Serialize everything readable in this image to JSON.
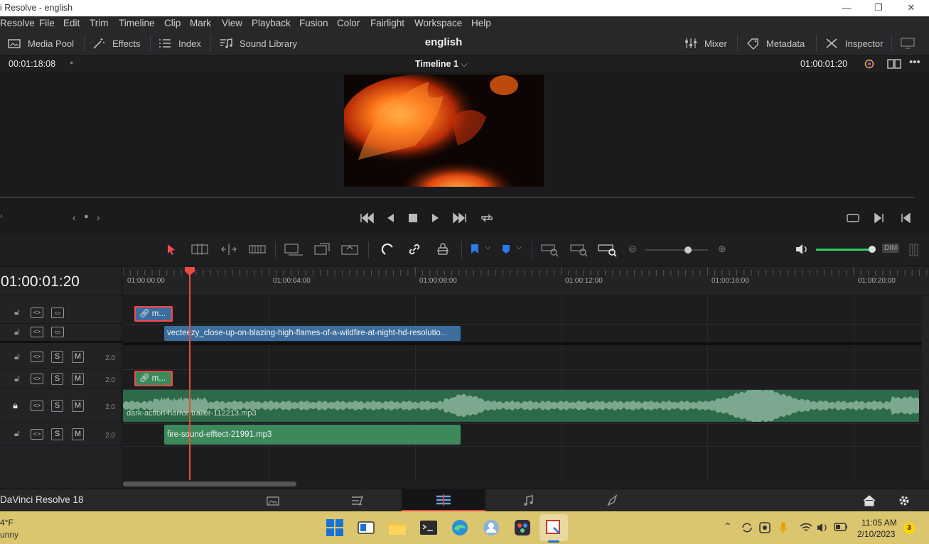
{
  "window": {
    "title": "i Resolve - english",
    "minimize": "—",
    "maximize": "❐",
    "close": "✕"
  },
  "menu": [
    "Resolve",
    "File",
    "Edit",
    "Trim",
    "Timeline",
    "Clip",
    "Mark",
    "View",
    "Playback",
    "Fusion",
    "Color",
    "Fairlight",
    "Workspace",
    "Help"
  ],
  "toolbar": {
    "media_pool": "Media Pool",
    "effects": "Effects",
    "index": "Index",
    "sound_library": "Sound Library",
    "project": "english",
    "mixer": "Mixer",
    "metadata": "Metadata",
    "inspector": "Inspector"
  },
  "viewer": {
    "source_timecode": "00:01:18:08",
    "timeline_name": "Timeline 1",
    "record_timecode": "01:00:01:20"
  },
  "timeline": {
    "current_timecode": "01:00:01:20",
    "ruler_labels": [
      "01:00:00:00",
      "01:00:04:00",
      "01:00:08:00",
      "01:00:12:00",
      "01:00:16:00",
      "01:00:20:00"
    ],
    "audio_level": "2.0",
    "solo": "S",
    "mute": "M",
    "dim": "DIM",
    "clips": {
      "v2_title": "m...",
      "v1_video": "vecteezy_close-up-on-blazing-high-flames-of-a-wildfire-at-night-hd-resolutio...",
      "a2_title": "m...",
      "a3_audio": "dark-action-horror-trailer-112213.mp3",
      "a4_audio": "fire-sound-efftect-21991.mp3"
    }
  },
  "app_footer": {
    "version": "DaVinci Resolve 18"
  },
  "taskbar": {
    "weather_temp": "4°F",
    "weather_desc": "unny",
    "time": "11:05 AM",
    "date": "2/10/2023",
    "notifications": "3"
  },
  "colors": {
    "video_clip": "#3b6e9e",
    "audio_clip": "#3c8a5b",
    "playhead": "#e84e3a",
    "accent_cut": "#ff3e5c",
    "taskbar": "#dcc56f"
  }
}
